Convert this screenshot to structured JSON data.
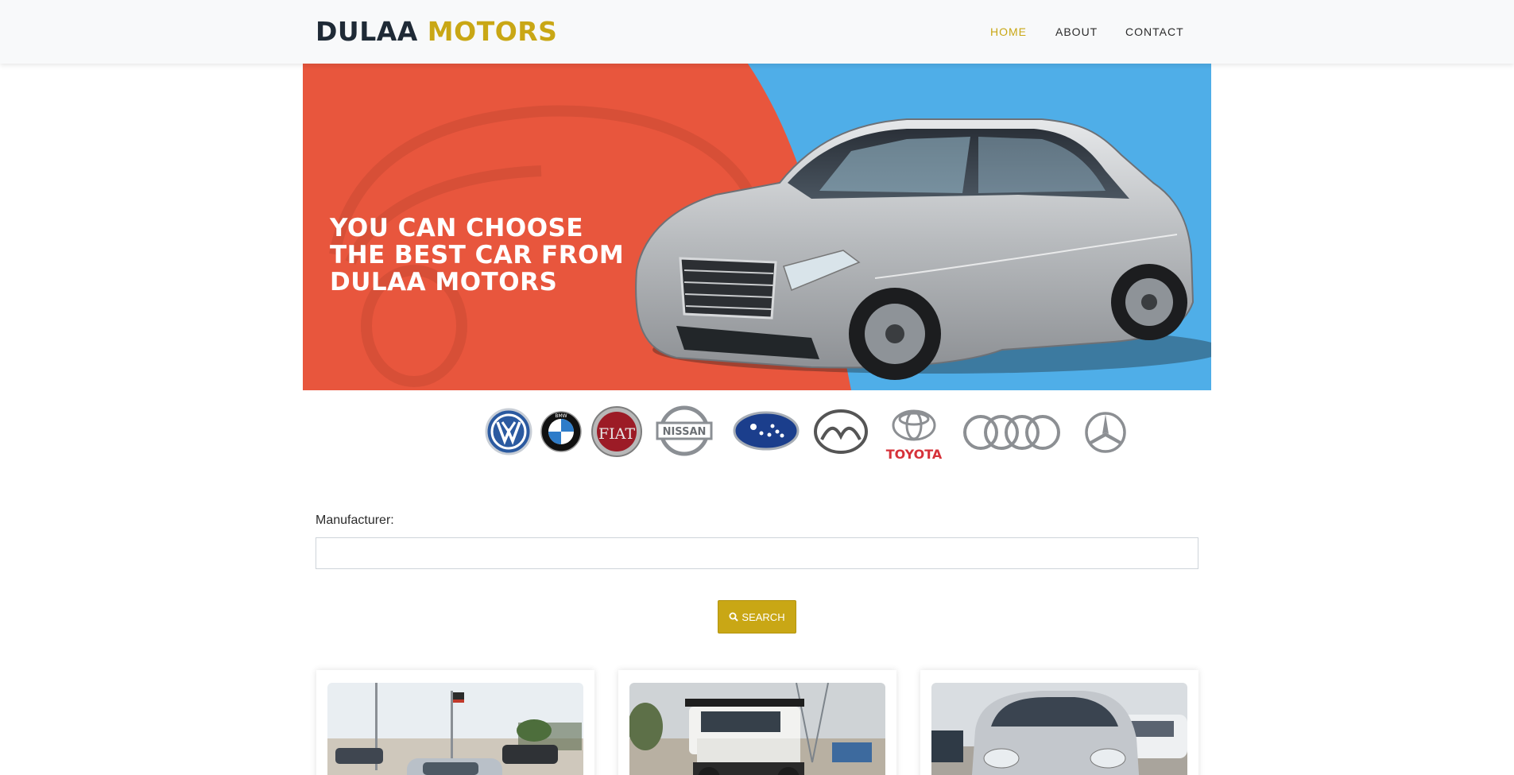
{
  "brand": {
    "part1": "DULAA",
    "part2": "MOTORS"
  },
  "nav": [
    {
      "label": "HOME",
      "active": true
    },
    {
      "label": "ABOUT",
      "active": false
    },
    {
      "label": "CONTACT",
      "active": false
    }
  ],
  "banner": {
    "lines": [
      "YOU CAN CHOOSE",
      "THE BEST CAR FROM",
      "DULAA MOTORS"
    ]
  },
  "logos": {
    "toyota_text": "TOYOTA",
    "nissan_text": "NISSAN",
    "fiat_text": "FIAT",
    "bmw_text": "BMW"
  },
  "search": {
    "label": "Manufacturer:",
    "value": "",
    "placeholder": "",
    "button_label": "SEARCH"
  },
  "colors": {
    "accent": "#c9a715",
    "banner_red": "#e8563d",
    "banner_blue": "#4faee8",
    "brand_dark": "#1f2a36"
  },
  "cards": [
    {
      "subject": "silver sedan at dealership lot"
    },
    {
      "subject": "white pickup with roof rack"
    },
    {
      "subject": "silver hatchback"
    }
  ]
}
